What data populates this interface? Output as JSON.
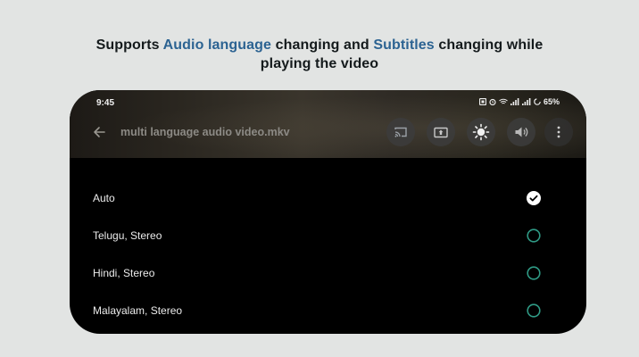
{
  "headline": {
    "part1": "Supports ",
    "accent1": "Audio language",
    "part2": " changing and ",
    "accent2": "Subtitles",
    "part3": " changing while",
    "line2": "playing the video"
  },
  "colors": {
    "accent": "#2c6392",
    "radio_unselected": "#2f9a85",
    "background": "#e2e4e3"
  },
  "status_bar": {
    "time": "9:45",
    "battery": "65%",
    "icons": [
      "sim-icon",
      "alarm-icon",
      "wifi-icon",
      "signal-icon",
      "signal-icon",
      "battery-icon"
    ]
  },
  "player": {
    "title": "multi language audio video.mkv",
    "controls": [
      "cast-icon",
      "screen-mode-icon",
      "brightness-icon",
      "volume-icon",
      "more-options-icon"
    ]
  },
  "audio_tracks": [
    {
      "label": "Auto",
      "selected": true
    },
    {
      "label": "Telugu, Stereo",
      "selected": false
    },
    {
      "label": "Hindi, Stereo",
      "selected": false
    },
    {
      "label": "Malayalam, Stereo",
      "selected": false
    }
  ]
}
